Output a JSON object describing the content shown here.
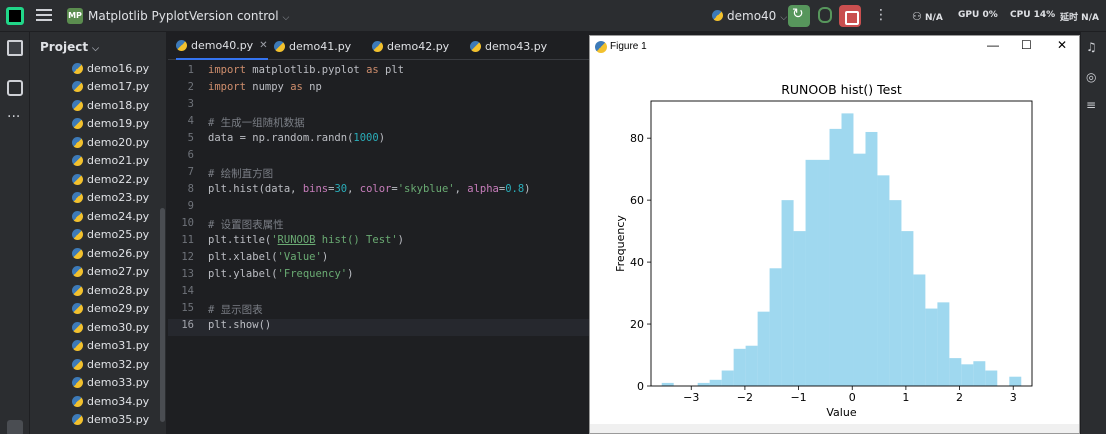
{
  "titlebar": {
    "project_badge": "MP",
    "project_name": "Matplotlib Pyplot",
    "vcs": "Version control",
    "run_config": "demo40",
    "net_label": "N/A",
    "gpu_label": "GPU",
    "gpu_value": "0%",
    "cpu_label": "CPU",
    "cpu_value": "14%",
    "extra_label": "延时",
    "extra_value": "N/A"
  },
  "project": {
    "header": "Project",
    "files": [
      "demo16.py",
      "demo17.py",
      "demo18.py",
      "demo19.py",
      "demo20.py",
      "demo21.py",
      "demo22.py",
      "demo23.py",
      "demo24.py",
      "demo25.py",
      "demo26.py",
      "demo27.py",
      "demo28.py",
      "demo29.py",
      "demo30.py",
      "demo31.py",
      "demo32.py",
      "demo33.py",
      "demo34.py",
      "demo35.py"
    ]
  },
  "editor": {
    "tabs": [
      {
        "label": "demo40.py",
        "active": true
      },
      {
        "label": "demo41.py",
        "active": false
      },
      {
        "label": "demo42.py",
        "active": false
      },
      {
        "label": "demo43.py",
        "active": false
      }
    ],
    "lines": [
      {
        "n": "1",
        "tokens": [
          [
            "kw",
            "import "
          ],
          [
            "fn",
            "matplotlib.pyplot "
          ],
          [
            "kw",
            "as "
          ],
          [
            "fn",
            "plt"
          ]
        ]
      },
      {
        "n": "2",
        "tokens": [
          [
            "kw",
            "import "
          ],
          [
            "fn",
            "numpy "
          ],
          [
            "kw",
            "as "
          ],
          [
            "fn",
            "np"
          ]
        ]
      },
      {
        "n": "3",
        "tokens": []
      },
      {
        "n": "4",
        "tokens": [
          [
            "cm",
            "# 生成一组随机数据"
          ]
        ]
      },
      {
        "n": "5",
        "tokens": [
          [
            "fn",
            "data = np.random.randn("
          ],
          [
            "num",
            "1000"
          ],
          [
            "fn",
            ")"
          ]
        ]
      },
      {
        "n": "6",
        "tokens": []
      },
      {
        "n": "7",
        "tokens": [
          [
            "cm",
            "# 绘制直方图"
          ]
        ]
      },
      {
        "n": "8",
        "tokens": [
          [
            "fn",
            "plt.hist(data, "
          ],
          [
            "prm",
            "bins"
          ],
          [
            "fn",
            "="
          ],
          [
            "num",
            "30"
          ],
          [
            "fn",
            ", "
          ],
          [
            "prm",
            "color"
          ],
          [
            "fn",
            "="
          ],
          [
            "str",
            "'skyblue'"
          ],
          [
            "fn",
            ", "
          ],
          [
            "prm",
            "alpha"
          ],
          [
            "fn",
            "="
          ],
          [
            "num",
            "0.8"
          ],
          [
            "fn",
            ")"
          ]
        ]
      },
      {
        "n": "9",
        "tokens": []
      },
      {
        "n": "10",
        "tokens": [
          [
            "cm",
            "# 设置图表属性"
          ]
        ]
      },
      {
        "n": "11",
        "tokens": [
          [
            "fn",
            "plt.title("
          ],
          [
            "str",
            "'"
          ],
          [
            "str ul",
            "RUNOOB"
          ],
          [
            "str",
            " hist() Test'"
          ],
          [
            "fn",
            ")"
          ]
        ]
      },
      {
        "n": "12",
        "tokens": [
          [
            "fn",
            "plt.xlabel("
          ],
          [
            "str",
            "'Value'"
          ],
          [
            "fn",
            ")"
          ]
        ]
      },
      {
        "n": "13",
        "tokens": [
          [
            "fn",
            "plt.ylabel("
          ],
          [
            "str",
            "'Frequency'"
          ],
          [
            "fn",
            ")"
          ]
        ]
      },
      {
        "n": "14",
        "tokens": []
      },
      {
        "n": "15",
        "tokens": [
          [
            "cm",
            "# 显示图表"
          ]
        ]
      },
      {
        "n": "16",
        "tokens": [
          [
            "fn",
            "plt.show()"
          ]
        ]
      }
    ],
    "current_line": "16"
  },
  "figure_window": {
    "title": "Figure 1",
    "minimize": "—",
    "maximize": "☐",
    "close": "✕"
  },
  "chart_data": {
    "type": "bar",
    "title": "RUNOOB hist() Test",
    "xlabel": "Value",
    "ylabel": "Frequency",
    "xlim": [
      -3.75,
      3.35
    ],
    "ylim": [
      0,
      92
    ],
    "xticks": [
      -3,
      -2,
      -1,
      0,
      1,
      2,
      3
    ],
    "yticks": [
      0,
      20,
      40,
      60,
      80
    ],
    "bin_edges": [
      -3.55,
      -3.327,
      -3.103,
      -2.88,
      -2.657,
      -2.433,
      -2.21,
      -1.987,
      -1.763,
      -1.54,
      -1.317,
      -1.093,
      -0.87,
      -0.647,
      -0.423,
      -0.2,
      0.023,
      0.247,
      0.47,
      0.693,
      0.917,
      1.14,
      1.363,
      1.587,
      1.81,
      2.033,
      2.257,
      2.48,
      2.703,
      2.927,
      3.15
    ],
    "values": [
      1,
      0,
      0,
      1,
      2,
      5,
      12,
      13,
      24,
      38,
      60,
      50,
      73,
      73,
      83,
      88,
      75,
      82,
      68,
      60,
      50,
      36,
      25,
      27,
      9,
      7,
      8,
      5,
      0,
      3
    ],
    "color": "#87ceeb",
    "alpha": 0.8,
    "grid": false
  }
}
